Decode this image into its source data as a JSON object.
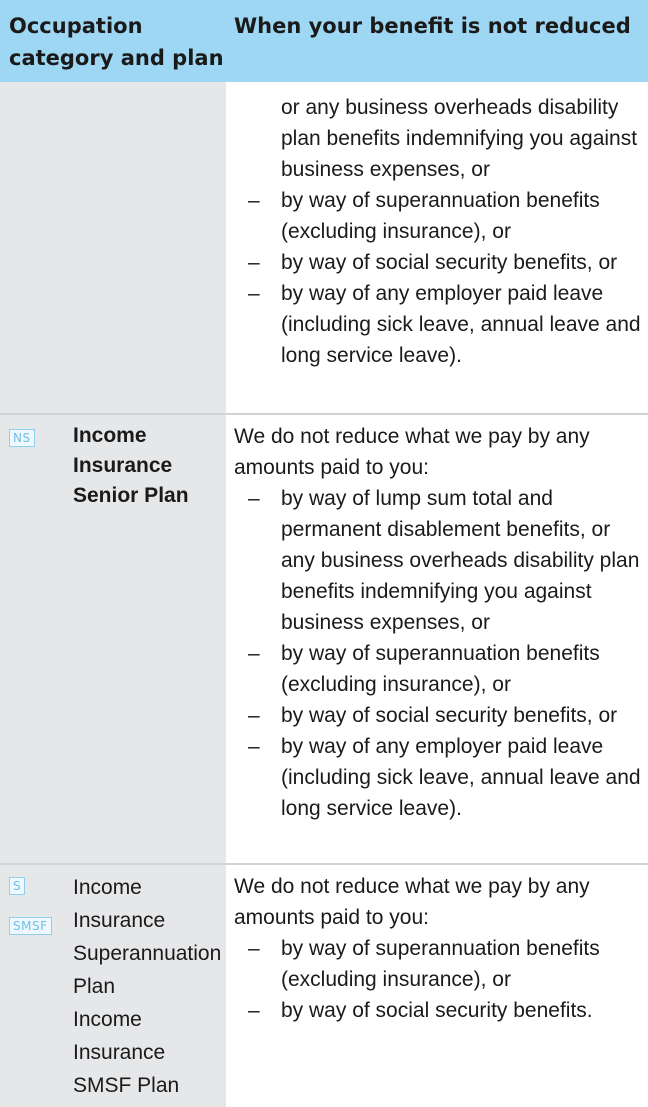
{
  "header": {
    "col1": "Occupation category and plan",
    "col2": "When your benefit is not reduced"
  },
  "rows": [
    {
      "continuation": "or any business overheads disability plan benefits indemnifying you against business expenses, or",
      "bullets": [
        "by way of superannuation benefits (excluding insurance), or",
        "by way of social security benefits, or",
        "by way of any employer paid leave (including sick leave, annual leave and long service leave)."
      ]
    },
    {
      "badge": "NS",
      "plan": "Income Insurance Senior Plan",
      "intro": "We do not reduce what we pay by any amounts paid to you:",
      "bullets": [
        "by way of lump sum total and permanent disablement benefits, or any business overheads disability plan benefits indemnifying you against business expenses, or",
        "by way of superannuation benefits (excluding insurance), or",
        "by way of social security benefits, or",
        "by way of any employer paid leave (including sick leave, annual leave and long service leave)."
      ]
    },
    {
      "badges": [
        "S",
        "SMSF"
      ],
      "plans": [
        "Income Insurance Superannuation Plan",
        "Income Insurance SMSF Plan"
      ],
      "intro": "We do not reduce what we pay by any amounts paid to you:",
      "bullets": [
        "by way of superannuation benefits (excluding insurance), or",
        "by way of social security benefits."
      ]
    }
  ],
  "dash": "–",
  "colors": {
    "header_bg": "#9ed7f3",
    "left_col_bg": "#e6e7e9",
    "badge_color": "#6fc0e8"
  }
}
